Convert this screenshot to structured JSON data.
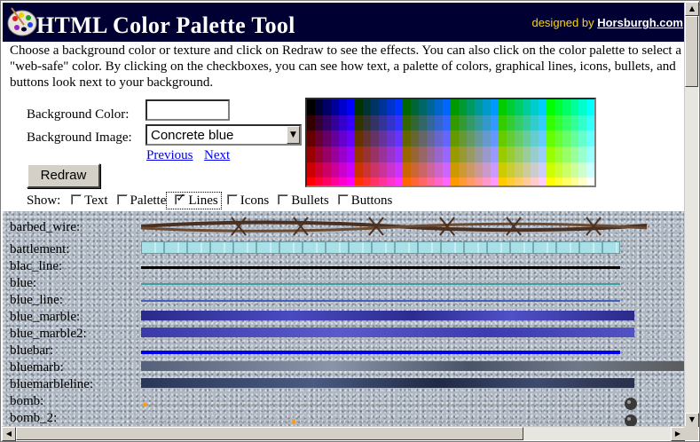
{
  "header": {
    "title": "HTML Color Palette Tool",
    "credit_prefix": "designed by ",
    "credit_link": "Horsburgh.com"
  },
  "intro": "Choose a background color or texture and click on Redraw to see the effects. You can also click on the color palette to select a \"web-safe\" color. By clicking on the checkboxes, you can see how text, a palette of colors, graphical lines, icons, bullets, and buttons look next to your background.",
  "form": {
    "bg_color_label": "Background Color:",
    "bg_color_value": "",
    "bg_image_label": "Background Image:",
    "bg_image_selected": "Concrete blue",
    "previous_link": "Previous",
    "next_link": "Next",
    "redraw_label": "Redraw"
  },
  "show": {
    "label": "Show:",
    "options": [
      {
        "label": "Text",
        "checked": false
      },
      {
        "label": "Palette",
        "checked": false
      },
      {
        "label": "Lines",
        "checked": true
      },
      {
        "label": "Icons",
        "checked": false
      },
      {
        "label": "Bullets",
        "checked": false
      },
      {
        "label": "Buttons",
        "checked": false
      }
    ]
  },
  "lines": [
    {
      "name": "barbed_wire:",
      "style": "barbed",
      "color": "#4a3020"
    },
    {
      "name": "battlement:",
      "style": "battlement",
      "color": "#a8e0e8"
    },
    {
      "name": "blac_line:",
      "style": "solid",
      "color": "#000000"
    },
    {
      "name": "blue:",
      "style": "thin",
      "color": "#3aa0a0"
    },
    {
      "name": "blue_line:",
      "style": "thin",
      "color": "#4060c0"
    },
    {
      "name": "blue_marble:",
      "style": "marble",
      "color": "#3c3ca8"
    },
    {
      "name": "blue_marble2:",
      "style": "marble2",
      "color": "#4a4ab8"
    },
    {
      "name": "bluebar:",
      "style": "solid",
      "color": "#0000ee"
    },
    {
      "name": "bluemarb:",
      "style": "marbgrey",
      "color": "#606870"
    },
    {
      "name": "bluemarbleline:",
      "style": "marbdark",
      "color": "#283050"
    },
    {
      "name": "bomb:",
      "style": "bomb",
      "color": "#8a8a8a"
    },
    {
      "name": "bomb_2:",
      "style": "bomb2",
      "color": "#8a8a8a"
    }
  ]
}
